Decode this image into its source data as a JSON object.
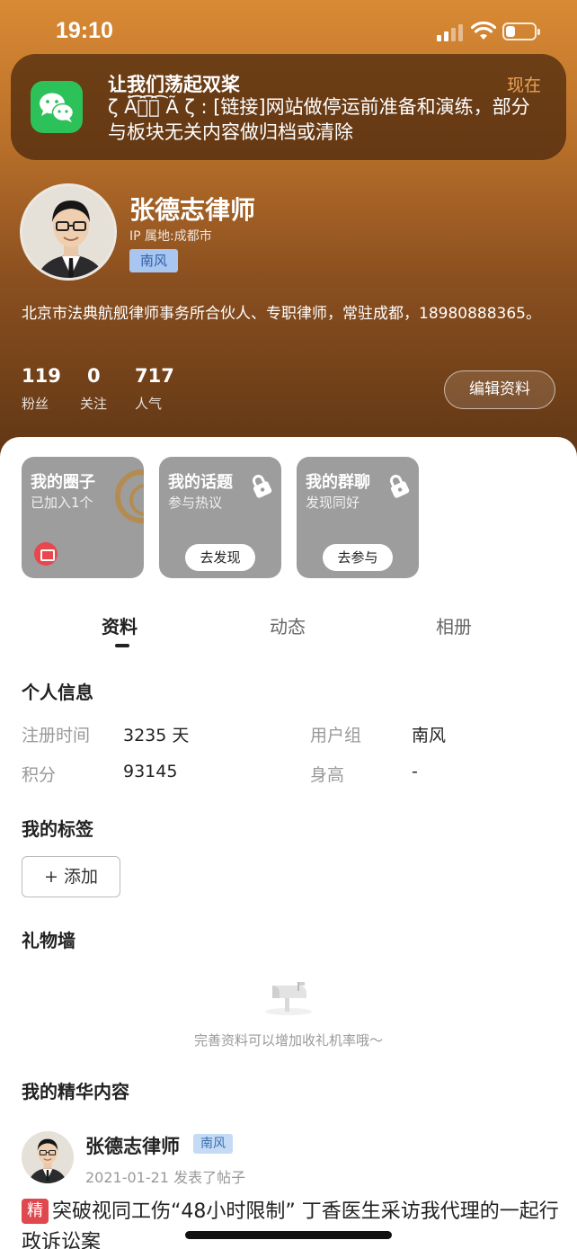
{
  "status_bar": {
    "time": "19:10"
  },
  "notification": {
    "title": "让我们荡起双桨",
    "time": "现在",
    "body": "ζ Ã͡醉͡鱼͡ Ã ζ : [链接]网站做停运前准备和演练，部分与板块无关内容做归档或清除",
    "app_icon": "wechat-icon"
  },
  "profile": {
    "name": "张德志律师",
    "ip": "IP 属地:成都市",
    "badge": "南风",
    "bio": "北京市法典航舰律师事务所合伙人、专职律师，常驻成都，18980888365。",
    "stats": [
      {
        "value": "119",
        "label": "粉丝"
      },
      {
        "value": "0",
        "label": "关注"
      },
      {
        "value": "717",
        "label": "人气"
      }
    ],
    "edit_label": "编辑资料"
  },
  "cards": [
    {
      "title": "我的圈子",
      "subtitle": "已加入1个"
    },
    {
      "title": "我的话题",
      "subtitle": "参与热议",
      "button": "去发现"
    },
    {
      "title": "我的群聊",
      "subtitle": "发现同好",
      "button": "去参与"
    }
  ],
  "tabs": [
    {
      "label": "资料",
      "active": true
    },
    {
      "label": "动态",
      "active": false
    },
    {
      "label": "相册",
      "active": false
    }
  ],
  "personal_info": {
    "title": "个人信息",
    "fields": [
      {
        "label": "注册时间",
        "value": "3235 天"
      },
      {
        "label": "用户组",
        "value": "南风"
      },
      {
        "label": "积分",
        "value": "93145"
      },
      {
        "label": "身高",
        "value": "-"
      }
    ]
  },
  "tags": {
    "title": "我的标签",
    "add_label": "+ 添加"
  },
  "gift_wall": {
    "title": "礼物墙",
    "hint": "完善资料可以增加收礼机率哦～"
  },
  "featured": {
    "title": "我的精华内容",
    "post": {
      "author": "张德志律师",
      "badge": "南风",
      "meta": "2021-01-21 发表了帖子",
      "tag": "精",
      "title": "突破视同工伤“48小时限制” 丁香医生采访我代理的一起行政诉讼案"
    }
  },
  "colors": {
    "header_top": "#d98a34",
    "header_bottom": "#5e3514",
    "accent_red": "#e0474e",
    "badge_blue": "#a8c6ef"
  }
}
